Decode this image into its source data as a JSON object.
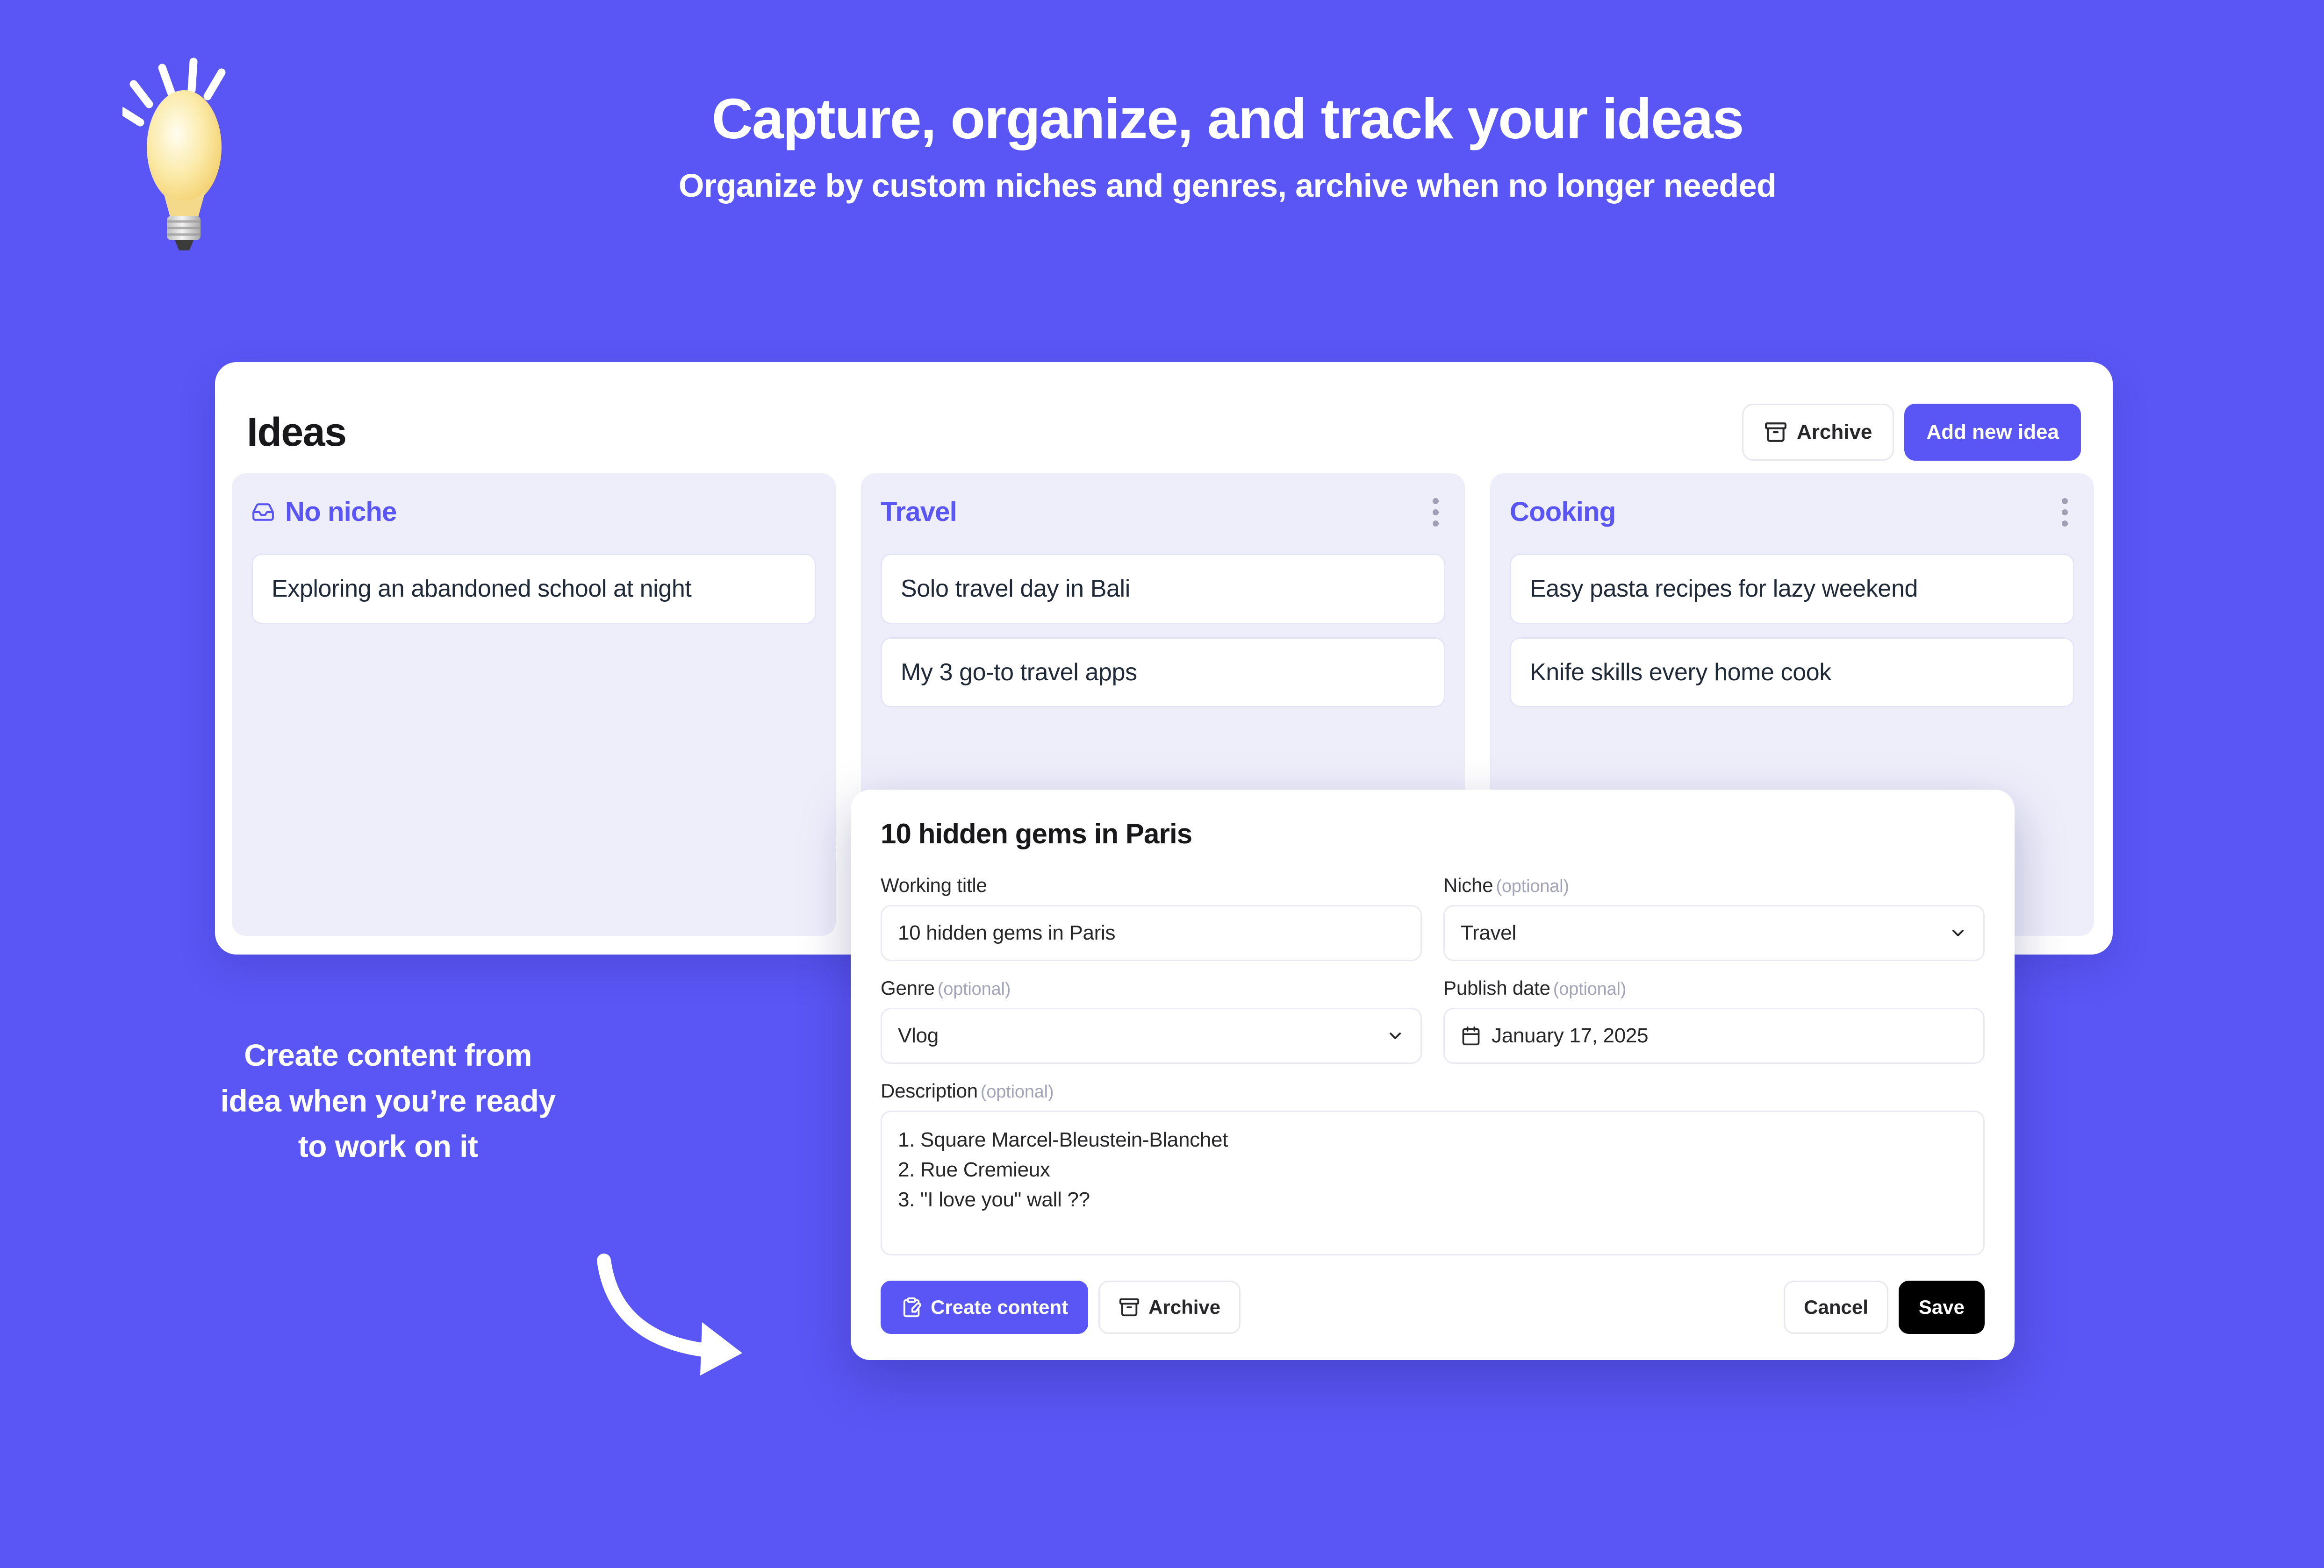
{
  "hero": {
    "icon": "lightbulb-icon",
    "title": "Capture, organize, and track your ideas",
    "subtitle": "Organize by custom niches and genres, archive when no longer needed"
  },
  "app": {
    "title": "Ideas",
    "header_actions": {
      "archive_label": "Archive",
      "archive_icon": "archive-box-icon",
      "add_label": "Add new idea"
    },
    "columns": [
      {
        "title": "No niche",
        "icon": "inbox-icon",
        "has_menu": false,
        "cards": [
          "Exploring an abandoned school at night"
        ]
      },
      {
        "title": "Travel",
        "icon": null,
        "has_menu": true,
        "menu_icon": "more-vertical-icon",
        "cards": [
          "Solo travel day in Bali",
          "My 3 go-to travel apps"
        ]
      },
      {
        "title": "Cooking",
        "icon": null,
        "has_menu": true,
        "menu_icon": "more-vertical-icon",
        "cards": [
          "Easy pasta recipes for lazy weekend",
          "Knife skills every home cook"
        ]
      }
    ]
  },
  "caption": {
    "line1": "Create content from",
    "line2": "idea when you’re ready",
    "line3": "to work on it",
    "arrow_icon": "curved-arrow-down-right-icon"
  },
  "modal": {
    "title": "10 hidden gems in Paris",
    "fields": {
      "working_title": {
        "label": "Working title",
        "optional": "",
        "value": "10 hidden gems in Paris",
        "placeholder": "Working title"
      },
      "niche": {
        "label": "Niche",
        "optional": "(optional)",
        "value": "Travel",
        "chevron_icon": "chevron-down-icon"
      },
      "genre": {
        "label": "Genre",
        "optional": "(optional)",
        "value": "Vlog",
        "chevron_icon": "chevron-down-icon"
      },
      "publish_date": {
        "label": "Publish date",
        "optional": "(optional)",
        "value": "January 17, 2025",
        "icon": "calendar-icon"
      },
      "description": {
        "label": "Description",
        "optional": "(optional)",
        "value": "1. Square Marcel-Bleustein-Blanchet\n2. Rue Cremieux\n3. \"I love you\" wall ??"
      }
    },
    "footer": {
      "create_content_label": "Create content",
      "create_content_icon": "clipboard-pen-icon",
      "archive_label": "Archive",
      "archive_icon": "archive-box-icon",
      "cancel_label": "Cancel",
      "save_label": "Save"
    }
  },
  "colors": {
    "background": "#5a56f5",
    "accent": "#5a56f5",
    "column_bg": "#eeeefb",
    "card_bg": "#ffffff",
    "save_bg": "#000000",
    "text_dark": "#18181b",
    "muted": "#a4a4b8"
  }
}
